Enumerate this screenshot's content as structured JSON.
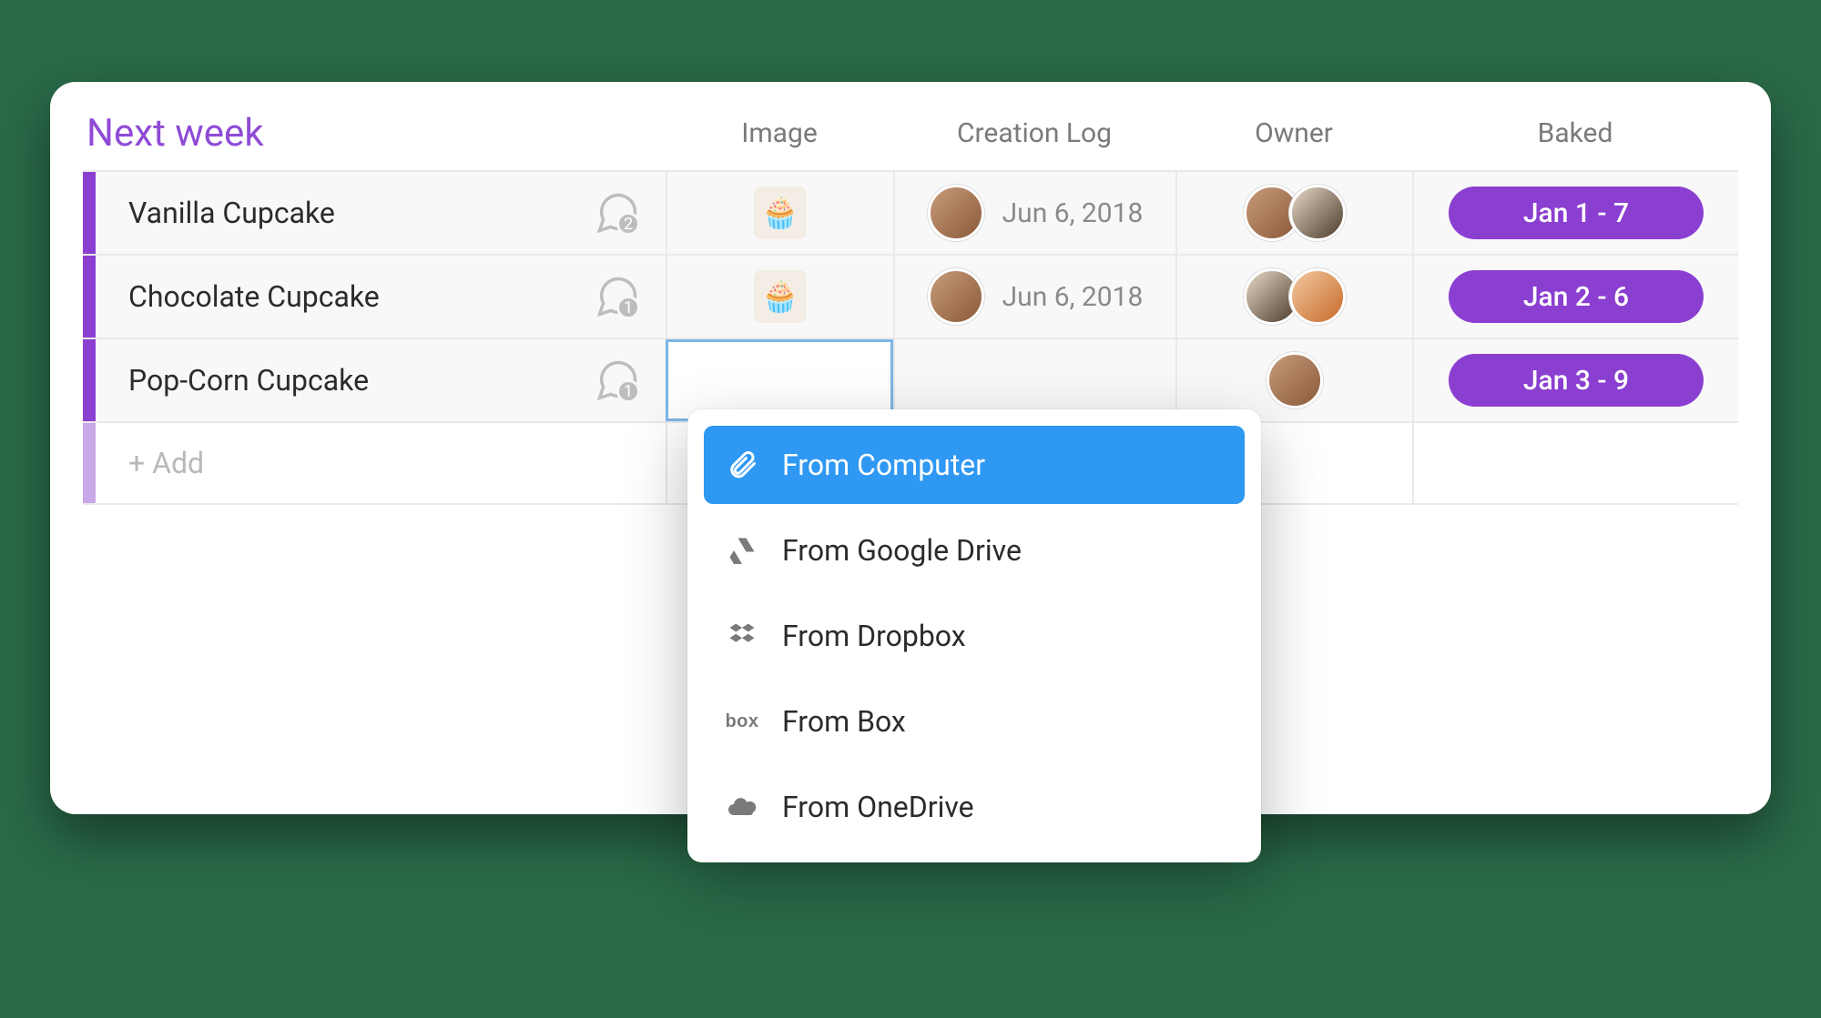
{
  "group": {
    "title": "Next week"
  },
  "columns": {
    "image": "Image",
    "creation": "Creation Log",
    "owner": "Owner",
    "baked": "Baked"
  },
  "rows": [
    {
      "name": "Vanilla Cupcake",
      "comments": 2,
      "thumb": "🧁",
      "creation_date": "Jun 6, 2018",
      "baked": "Jan 1 - 7"
    },
    {
      "name": "Chocolate Cupcake",
      "comments": 1,
      "thumb": "🧁",
      "creation_date": "Jun 6, 2018",
      "baked": "Jan 2 - 6"
    },
    {
      "name": "Pop-Corn Cupcake",
      "comments": 1,
      "thumb": "",
      "creation_date": "",
      "baked": "Jan 3 - 9"
    }
  ],
  "add_row": {
    "label": "+ Add"
  },
  "upload_menu": {
    "items": [
      {
        "label": "From Computer",
        "icon": "paperclip-icon",
        "active": true
      },
      {
        "label": "From Google Drive",
        "icon": "google-drive-icon",
        "active": false
      },
      {
        "label": "From Dropbox",
        "icon": "dropbox-icon",
        "active": false
      },
      {
        "label": "From Box",
        "icon": "box-icon",
        "active": false
      },
      {
        "label": "From OneDrive",
        "icon": "onedrive-icon",
        "active": false
      }
    ]
  },
  "colors": {
    "group_accent": "#8b3fd1",
    "menu_active": "#2f98f3"
  }
}
